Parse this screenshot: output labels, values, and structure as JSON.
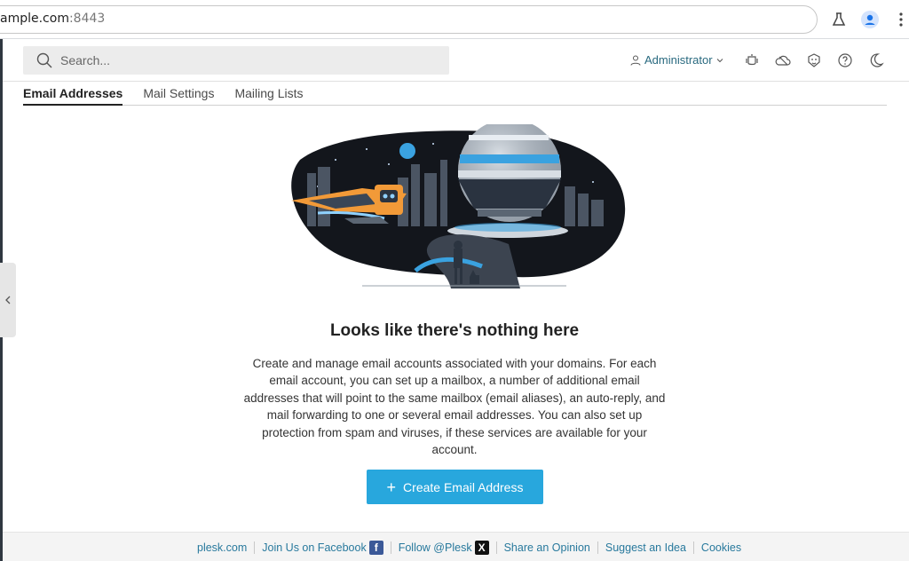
{
  "browser": {
    "url_host": "ample.com",
    "url_port": ":8443"
  },
  "header": {
    "search_placeholder": "Search...",
    "user_label": "Administrator"
  },
  "tabs": [
    {
      "label": "Email Addresses",
      "active": true
    },
    {
      "label": "Mail Settings",
      "active": false
    },
    {
      "label": "Mailing Lists",
      "active": false
    }
  ],
  "empty_state": {
    "title": "Looks like there's nothing here",
    "description": "Create and manage email accounts associated with your domains. For each email account, you can set up a mailbox, a number of additional email addresses that will point to the same mailbox (email aliases), an auto-reply, and mail forwarding to one or several email addresses. You can also set up protection from spam and viruses, if these services are available for your account.",
    "cta_label": "Create Email Address"
  },
  "footer": {
    "links": [
      "plesk.com",
      "Join Us on Facebook",
      "Follow @Plesk",
      "Share an Opinion",
      "Suggest an Idea",
      "Cookies"
    ]
  },
  "colors": {
    "accent": "#28a7dd",
    "link": "#28799d",
    "facebook": "#3b5998",
    "x": "#111111"
  },
  "icons": {
    "browser": [
      "flask-icon",
      "profile-icon",
      "more-vert-icon"
    ],
    "header": [
      "notifications-icon",
      "cloud-icon",
      "extensions-icon",
      "help-icon",
      "dark-mode-icon"
    ]
  }
}
